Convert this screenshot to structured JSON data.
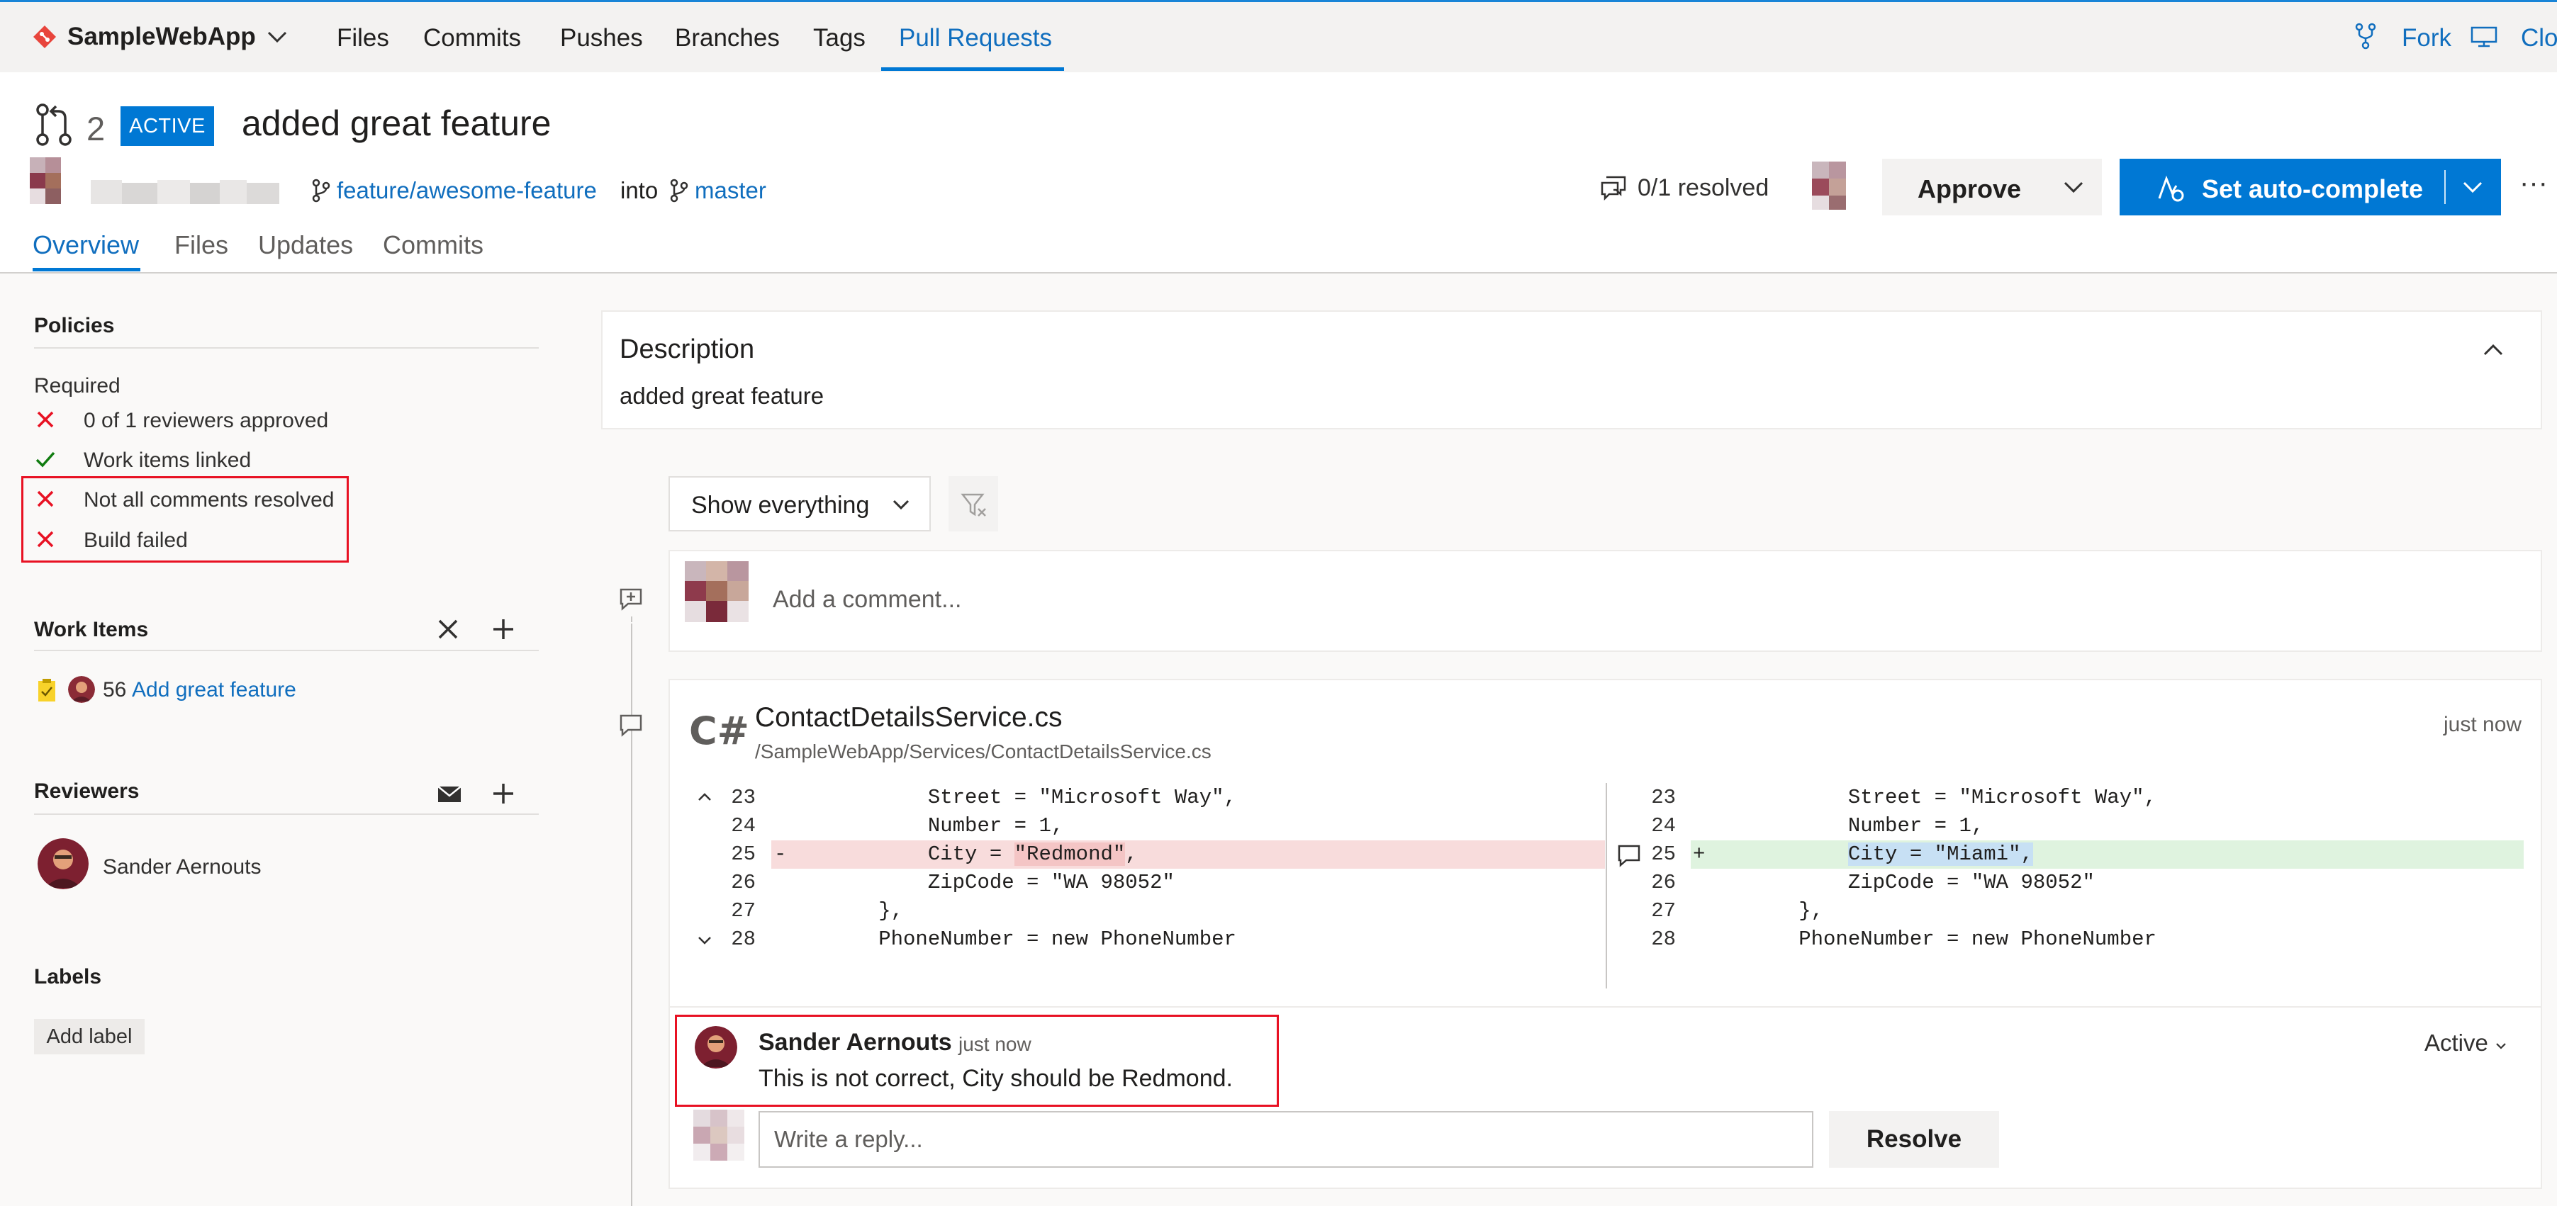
{
  "topnav": {
    "repo_name": "SampleWebApp",
    "tabs": [
      "Files",
      "Commits",
      "Pushes",
      "Branches",
      "Tags",
      "Pull Requests"
    ],
    "active_tab": "Pull Requests",
    "fork_label": "Fork",
    "clone_label": "Clone"
  },
  "pr": {
    "number": "2",
    "status": "ACTIVE",
    "title": "added great feature",
    "source_branch": "feature/awesome-feature",
    "into_word": "into",
    "target_branch": "master",
    "resolved_count": "0/1 resolved",
    "approve_label": "Approve",
    "autocomplete_label": "Set auto-complete",
    "more_label": "···",
    "subtabs": [
      "Overview",
      "Files",
      "Updates",
      "Commits"
    ]
  },
  "sidebar": {
    "policies_title": "Policies",
    "required_label": "Required",
    "policies": [
      {
        "status": "failed",
        "text": "0 of 1 reviewers approved",
        "link": false
      },
      {
        "status": "passed",
        "text": "Work items linked",
        "link": false
      },
      {
        "status": "failed",
        "text": "Not all comments resolved",
        "link": false
      },
      {
        "status": "failed",
        "text": "Build failed",
        "link": true
      }
    ],
    "work_items_title": "Work Items",
    "work_item": {
      "id": "56",
      "title": "Add great feature"
    },
    "reviewers_title": "Reviewers",
    "reviewer_name": "Sander Aernouts",
    "labels_title": "Labels",
    "add_label": "Add label"
  },
  "description": {
    "title": "Description",
    "text": "added great feature"
  },
  "activity": {
    "filter_label": "Show everything",
    "comment_placeholder": "Add a comment...",
    "file": {
      "lang_badge": "C#",
      "name": "ContactDetailsService.cs",
      "path": "/SampleWebApp/Services/ContactDetailsService.cs",
      "time": "just now",
      "left_lines": [
        {
          "num": "23",
          "sign": "",
          "code": "            Street = \"Microsoft Way\","
        },
        {
          "num": "24",
          "sign": "",
          "code": "            Number = 1,"
        },
        {
          "num": "25",
          "sign": "-",
          "code_pre": "            City = ",
          "code_hl": "\"Redmond\"",
          "code_post": ","
        },
        {
          "num": "26",
          "sign": "",
          "code": "            ZipCode = \"WA 98052\""
        },
        {
          "num": "27",
          "sign": "",
          "code": "        },"
        },
        {
          "num": "28",
          "sign": "",
          "code": "        PhoneNumber = new PhoneNumber"
        }
      ],
      "right_lines": [
        {
          "num": "23",
          "sign": "",
          "code": "            Street = \"Microsoft Way\","
        },
        {
          "num": "24",
          "sign": "",
          "code": "            Number = 1,"
        },
        {
          "num": "25",
          "sign": "+",
          "code_pre": "            ",
          "code_hl": "City = \"Miami\",",
          "code_post": ""
        },
        {
          "num": "26",
          "sign": "",
          "code": "            ZipCode = \"WA 98052\""
        },
        {
          "num": "27",
          "sign": "",
          "code": "        },"
        },
        {
          "num": "28",
          "sign": "",
          "code": "        PhoneNumber = new PhoneNumber"
        }
      ]
    },
    "thread": {
      "author": "Sander Aernouts",
      "time": "just now",
      "text": "This is not correct, City should be Redmond.",
      "status": "Active",
      "reply_placeholder": "Write a reply...",
      "resolve_label": "Resolve"
    }
  },
  "colors": {
    "accent": "#0078d4",
    "link": "#106ebe",
    "failed": "#e81123",
    "passed": "#107c10"
  }
}
